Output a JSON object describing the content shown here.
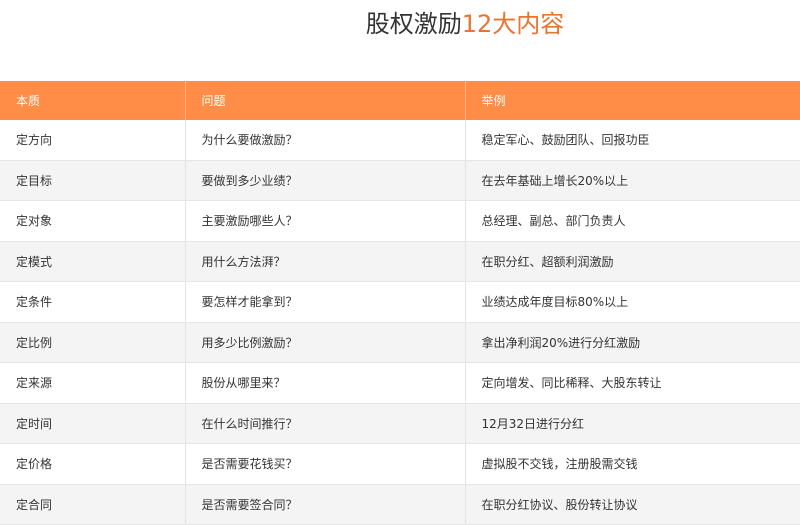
{
  "title": {
    "main": "股权激励",
    "accent": "12大内容"
  },
  "table": {
    "headers": [
      "本质",
      "问题",
      "举例"
    ],
    "rows": [
      [
        "定方向",
        "为什么要做激励？",
        "稳定军心、鼓励团队、回报功臣"
      ],
      [
        "定目标",
        "要做到多少业绩？",
        "在去年基础上增长20%以上"
      ],
      [
        "定对象",
        "主要激励哪些人？",
        "总经理、副总、部门负责人"
      ],
      [
        "定模式",
        "用什么方法湃？",
        "在职分红、超额利润激励"
      ],
      [
        "定条件",
        "要怎样才能拿到？",
        "业绩达成年度目标80%以上"
      ],
      [
        "定比例",
        "用多少比例激励？",
        "拿出净利润20%进行分红激励"
      ],
      [
        "定来源",
        "股份从哪里来？",
        "定向增发、同比稀释、大股东转让"
      ],
      [
        "定时间",
        "在什么时间推行？",
        "12月32日进行分红"
      ],
      [
        "定价格",
        "是否需要花钱买？",
        "虚拟股不交钱，注册股需交钱"
      ],
      [
        "定合同",
        "是否需要签合同？",
        "在职分红协议、股份转让协议"
      ]
    ]
  }
}
